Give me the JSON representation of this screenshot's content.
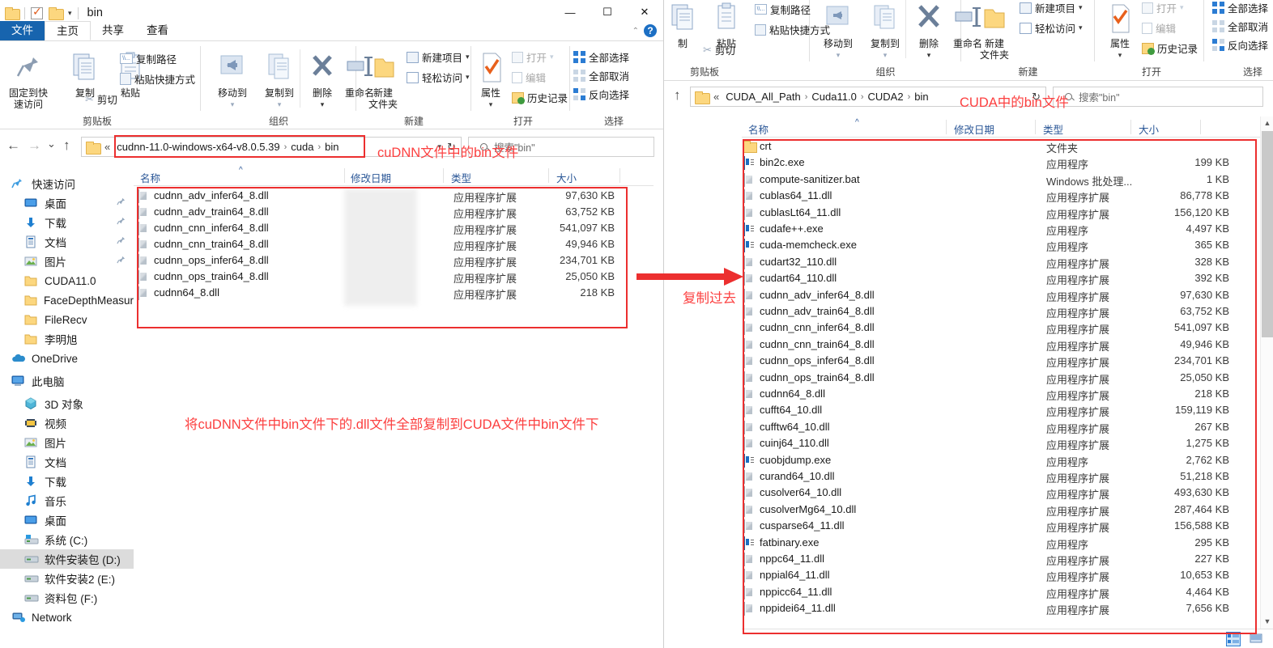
{
  "left_window": {
    "title": "bin",
    "qat": {
      "folder_icon": "folder-icon",
      "properties_icon": "properties-check-icon",
      "newfolder_icon": "new-folder-icon",
      "dropdown_icon": "chevron-down-icon"
    },
    "window_buttons": {
      "minimize": "—",
      "maximize": "☐",
      "close": "✕"
    },
    "help": "?",
    "collapse_ribbon": "⌃",
    "tabs": [
      {
        "label": "文件",
        "kind": "file"
      },
      {
        "label": "主页",
        "kind": "active"
      },
      {
        "label": "共享",
        "kind": "normal"
      },
      {
        "label": "查看",
        "kind": "normal"
      }
    ],
    "ribbon": {
      "groups": [
        {
          "label": "剪贴板"
        },
        {
          "label": "组织"
        },
        {
          "label": "新建"
        },
        {
          "label": "打开"
        },
        {
          "label": "选择"
        }
      ],
      "pin_quick_access": "固定到快\n速访问",
      "pin_line1": "固定到快",
      "pin_line2": "速访问",
      "copy": "复制",
      "paste": "粘贴",
      "copy_path": "复制路径",
      "paste_shortcut": "粘贴快捷方式",
      "cut": "剪切",
      "move_to": "移动到",
      "copy_to": "复制到",
      "delete": "删除",
      "rename": "重命名",
      "new_folder_l1": "新建",
      "new_folder_l2": "文件夹",
      "new_item": "新建项目",
      "easy_access": "轻松访问",
      "properties": "属性",
      "open": "打开",
      "edit": "编辑",
      "history": "历史记录",
      "select_all": "全部选择",
      "select_none": "全部取消",
      "invert_selection": "反向选择"
    },
    "address": {
      "back": "←",
      "forward": "→",
      "recent": "⌄",
      "up": "↑",
      "root_sep": "«",
      "crumbs": [
        "cudnn-11.0-windows-x64-v8.0.5.39",
        "cuda",
        "bin"
      ],
      "refresh": "↻"
    },
    "search": {
      "placeholder": "搜索\"bin\"",
      "icon": "search-icon"
    },
    "columns": [
      {
        "label": "名称"
      },
      {
        "label": "修改日期"
      },
      {
        "label": "类型"
      },
      {
        "label": "大小"
      }
    ],
    "nav": [
      {
        "label": "快速访问",
        "icon": "star-pin-icon",
        "indent": 0,
        "pinned": false
      },
      {
        "label": "桌面",
        "icon": "desktop-icon",
        "indent": 1,
        "pinned": true
      },
      {
        "label": "下载",
        "icon": "download-icon",
        "indent": 1,
        "pinned": true
      },
      {
        "label": "文档",
        "icon": "documents-icon",
        "indent": 1,
        "pinned": true
      },
      {
        "label": "图片",
        "icon": "pictures-icon",
        "indent": 1,
        "pinned": true
      },
      {
        "label": "CUDA11.0",
        "icon": "folder-icon",
        "indent": 1,
        "pinned": false
      },
      {
        "label": "FaceDepthMeasur",
        "icon": "folder-icon",
        "indent": 1,
        "pinned": false
      },
      {
        "label": "FileRecv",
        "icon": "folder-icon",
        "indent": 1,
        "pinned": false
      },
      {
        "label": "李明旭",
        "icon": "folder-icon",
        "indent": 1,
        "pinned": false
      },
      {
        "label": "OneDrive",
        "icon": "onedrive-cloud-icon",
        "indent": 0,
        "pinned": false
      },
      {
        "label": "此电脑",
        "icon": "this-pc-icon",
        "indent": 0,
        "pinned": false
      },
      {
        "label": "3D 对象",
        "icon": "3d-objects-icon",
        "indent": 1,
        "pinned": false
      },
      {
        "label": "视频",
        "icon": "videos-icon",
        "indent": 1,
        "pinned": false
      },
      {
        "label": "图片",
        "icon": "pictures-icon",
        "indent": 1,
        "pinned": false
      },
      {
        "label": "文档",
        "icon": "documents-icon",
        "indent": 1,
        "pinned": false
      },
      {
        "label": "下载",
        "icon": "download-icon",
        "indent": 1,
        "pinned": false
      },
      {
        "label": "音乐",
        "icon": "music-icon",
        "indent": 1,
        "pinned": false
      },
      {
        "label": "桌面",
        "icon": "desktop-icon",
        "indent": 1,
        "pinned": false
      },
      {
        "label": "系统 (C:)",
        "icon": "windows-drive-icon",
        "indent": 1,
        "pinned": false
      },
      {
        "label": "软件安装包 (D:)",
        "icon": "drive-icon",
        "indent": 1,
        "pinned": false,
        "selected": true
      },
      {
        "label": "软件安装2 (E:)",
        "icon": "drive-icon",
        "indent": 1,
        "pinned": false
      },
      {
        "label": "资料包 (F:)",
        "icon": "drive-icon",
        "indent": 1,
        "pinned": false
      },
      {
        "label": "Network",
        "icon": "network-icon",
        "indent": 0,
        "pinned": false
      }
    ],
    "files": [
      {
        "name": "cudnn_adv_infer64_8.dll",
        "type": "应用程序扩展",
        "size": "97,630 KB",
        "icon": "dll-icon"
      },
      {
        "name": "cudnn_adv_train64_8.dll",
        "type": "应用程序扩展",
        "size": "63,752 KB",
        "icon": "dll-icon"
      },
      {
        "name": "cudnn_cnn_infer64_8.dll",
        "type": "应用程序扩展",
        "size": "541,097 KB",
        "icon": "dll-icon"
      },
      {
        "name": "cudnn_cnn_train64_8.dll",
        "type": "应用程序扩展",
        "size": "49,946 KB",
        "icon": "dll-icon"
      },
      {
        "name": "cudnn_ops_infer64_8.dll",
        "type": "应用程序扩展",
        "size": "234,701 KB",
        "icon": "dll-icon"
      },
      {
        "name": "cudnn_ops_train64_8.dll",
        "type": "应用程序扩展",
        "size": "25,050 KB",
        "icon": "dll-icon"
      },
      {
        "name": "cudnn64_8.dll",
        "type": "应用程序扩展",
        "size": "218 KB",
        "icon": "dll-icon"
      }
    ]
  },
  "right_window": {
    "ribbon": {
      "groups": [
        {
          "label": "剪贴板"
        },
        {
          "label": "组织"
        },
        {
          "label": "新建"
        },
        {
          "label": "打开"
        },
        {
          "label": "选择"
        }
      ],
      "copy": "制",
      "paste": "粘贴",
      "copy_path": "复制路径",
      "paste_shortcut": "粘贴快捷方式",
      "cut": "剪切",
      "move_to": "移动到",
      "copy_to": "复制到",
      "delete": "删除",
      "rename": "重命名",
      "new_folder_l1": "新建",
      "new_folder_l2": "文件夹",
      "new_item": "新建项目",
      "easy_access": "轻松访问",
      "properties": "属性",
      "open": "打开",
      "edit": "编辑",
      "history": "历史记录",
      "select_all": "全部选择",
      "select_none": "全部取消",
      "invert_selection": "反向选择"
    },
    "address": {
      "up": "↑",
      "root_sep": "«",
      "crumbs": [
        "CUDA_All_Path",
        "Cuda11.0",
        "CUDA2",
        "bin"
      ],
      "refresh": "↻"
    },
    "search": {
      "placeholder": "搜索\"bin\"",
      "icon": "search-icon"
    },
    "columns": [
      {
        "label": "名称"
      },
      {
        "label": "修改日期"
      },
      {
        "label": "类型"
      },
      {
        "label": "大小"
      }
    ],
    "files": [
      {
        "name": "crt",
        "type": "文件夹",
        "size": "",
        "icon": "folder-icon"
      },
      {
        "name": "bin2c.exe",
        "type": "应用程序",
        "size": "199 KB",
        "icon": "exe-icon"
      },
      {
        "name": "compute-sanitizer.bat",
        "type": "Windows 批处理...",
        "size": "1 KB",
        "icon": "bat-icon"
      },
      {
        "name": "cublas64_11.dll",
        "type": "应用程序扩展",
        "size": "86,778 KB",
        "icon": "dll-icon"
      },
      {
        "name": "cublasLt64_11.dll",
        "type": "应用程序扩展",
        "size": "156,120 KB",
        "icon": "dll-icon"
      },
      {
        "name": "cudafe++.exe",
        "type": "应用程序",
        "size": "4,497 KB",
        "icon": "exe-icon"
      },
      {
        "name": "cuda-memcheck.exe",
        "type": "应用程序",
        "size": "365 KB",
        "icon": "exe-icon"
      },
      {
        "name": "cudart32_110.dll",
        "type": "应用程序扩展",
        "size": "328 KB",
        "icon": "dll-icon"
      },
      {
        "name": "cudart64_110.dll",
        "type": "应用程序扩展",
        "size": "392 KB",
        "icon": "dll-icon"
      },
      {
        "name": "cudnn_adv_infer64_8.dll",
        "type": "应用程序扩展",
        "size": "97,630 KB",
        "icon": "dll-icon"
      },
      {
        "name": "cudnn_adv_train64_8.dll",
        "type": "应用程序扩展",
        "size": "63,752 KB",
        "icon": "dll-icon"
      },
      {
        "name": "cudnn_cnn_infer64_8.dll",
        "type": "应用程序扩展",
        "size": "541,097 KB",
        "icon": "dll-icon"
      },
      {
        "name": "cudnn_cnn_train64_8.dll",
        "type": "应用程序扩展",
        "size": "49,946 KB",
        "icon": "dll-icon"
      },
      {
        "name": "cudnn_ops_infer64_8.dll",
        "type": "应用程序扩展",
        "size": "234,701 KB",
        "icon": "dll-icon"
      },
      {
        "name": "cudnn_ops_train64_8.dll",
        "type": "应用程序扩展",
        "size": "25,050 KB",
        "icon": "dll-icon"
      },
      {
        "name": "cudnn64_8.dll",
        "type": "应用程序扩展",
        "size": "218 KB",
        "icon": "dll-icon"
      },
      {
        "name": "cufft64_10.dll",
        "type": "应用程序扩展",
        "size": "159,119 KB",
        "icon": "dll-icon"
      },
      {
        "name": "cufftw64_10.dll",
        "type": "应用程序扩展",
        "size": "267 KB",
        "icon": "dll-icon"
      },
      {
        "name": "cuinj64_110.dll",
        "type": "应用程序扩展",
        "size": "1,275 KB",
        "icon": "dll-icon"
      },
      {
        "name": "cuobjdump.exe",
        "type": "应用程序",
        "size": "2,762 KB",
        "icon": "exe-icon"
      },
      {
        "name": "curand64_10.dll",
        "type": "应用程序扩展",
        "size": "51,218 KB",
        "icon": "dll-icon"
      },
      {
        "name": "cusolver64_10.dll",
        "type": "应用程序扩展",
        "size": "493,630 KB",
        "icon": "dll-icon"
      },
      {
        "name": "cusolverMg64_10.dll",
        "type": "应用程序扩展",
        "size": "287,464 KB",
        "icon": "dll-icon"
      },
      {
        "name": "cusparse64_11.dll",
        "type": "应用程序扩展",
        "size": "156,588 KB",
        "icon": "dll-icon"
      },
      {
        "name": "fatbinary.exe",
        "type": "应用程序",
        "size": "295 KB",
        "icon": "exe-icon"
      },
      {
        "name": "nppc64_11.dll",
        "type": "应用程序扩展",
        "size": "227 KB",
        "icon": "dll-icon"
      },
      {
        "name": "nppial64_11.dll",
        "type": "应用程序扩展",
        "size": "10,653 KB",
        "icon": "dll-icon"
      },
      {
        "name": "nppicc64_11.dll",
        "type": "应用程序扩展",
        "size": "4,464 KB",
        "icon": "dll-icon"
      },
      {
        "name": "nppidei64_11.dll",
        "type": "应用程序扩展",
        "size": "7,656 KB",
        "icon": "dll-icon"
      }
    ],
    "status": {
      "view_details": "details-view-icon",
      "view_large": "large-icons-view-icon"
    }
  },
  "background_window": {
    "nav_fragments": [
      "问",
      "",
      "",
      "",
      "",
      "DA11.0",
      "eDepthMeasur",
      "Recv",
      "旭",
      "rive",
      "脑",
      "对象",
      "",
      "",
      "",
      "",
      "",
      "",
      "(C:)",
      "安装包 (D:)",
      "安装2 (E:)",
      "包 (F:)",
      "ork"
    ]
  },
  "annotations": {
    "left_addr_note": "cuDNN文件中的bin文件",
    "left_bottom_note": "将cuDNN文件中bin文件下的.dll文件全部复制到CUDA文件中bin文件下",
    "right_addr_note": "CUDA中的bin文件",
    "arrow_note": "复制过去",
    "color": "#fc4040"
  }
}
